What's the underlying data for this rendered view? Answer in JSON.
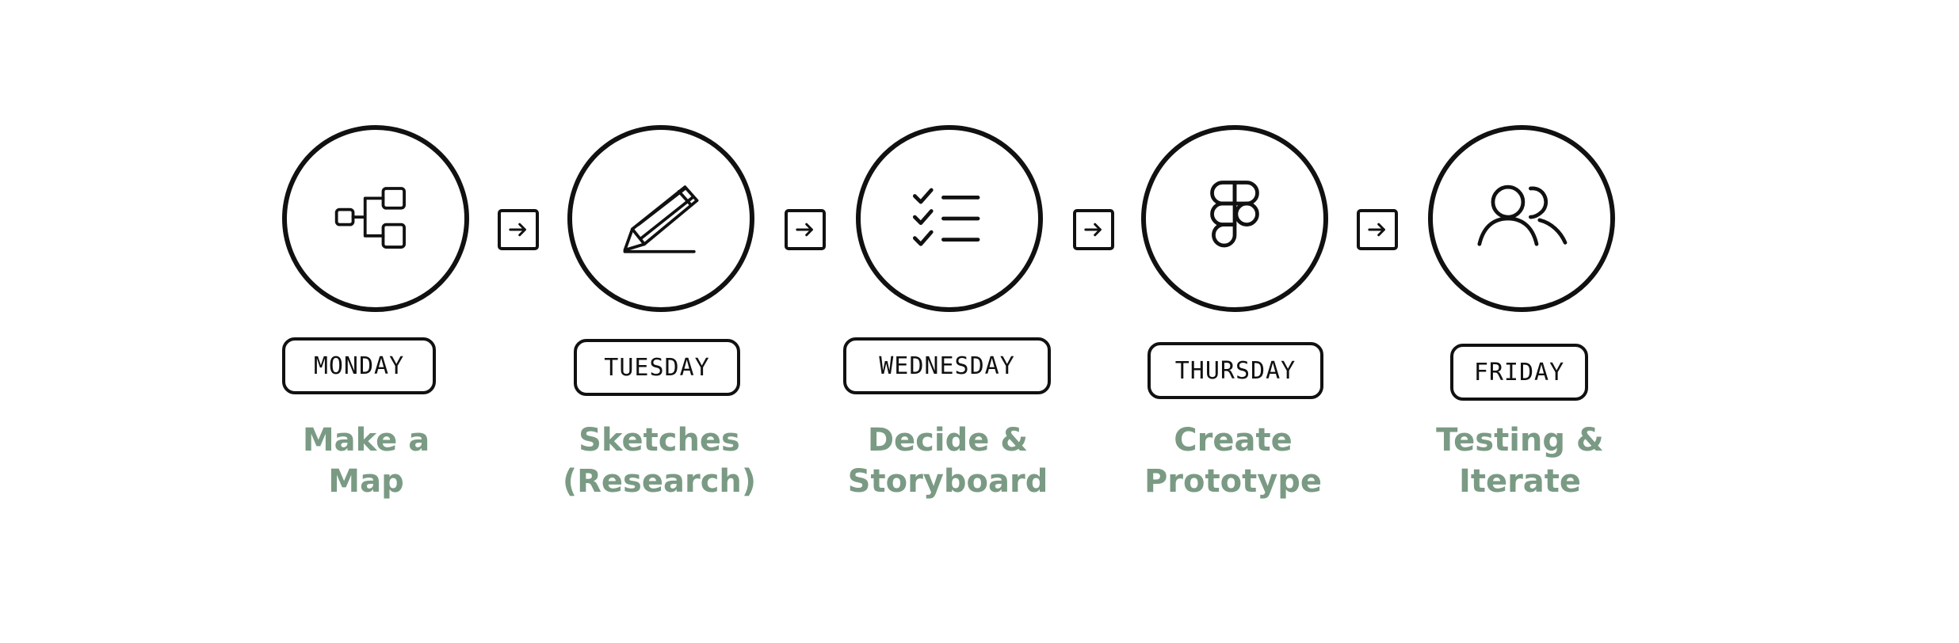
{
  "steps": [
    {
      "day": "MONDAY",
      "caption_line1": "Make a",
      "caption_line2": "Map",
      "icon": "flowchart-icon"
    },
    {
      "day": "TUESDAY",
      "caption_line1": "Sketches",
      "caption_line2": "(Research)",
      "icon": "pencil-icon"
    },
    {
      "day": "WEDNESDAY",
      "caption_line1": "Decide &",
      "caption_line2": "Storyboard",
      "icon": "checklist-icon"
    },
    {
      "day": "THURSDAY",
      "caption_line1": "Create",
      "caption_line2": "Prototype",
      "icon": "figma-logo-icon"
    },
    {
      "day": "FRIDAY",
      "caption_line1": "Testing &",
      "caption_line2": "Iterate",
      "icon": "users-icon"
    }
  ],
  "colors": {
    "stroke": "#111111",
    "caption": "#7a9a84",
    "background": "#ffffff"
  }
}
